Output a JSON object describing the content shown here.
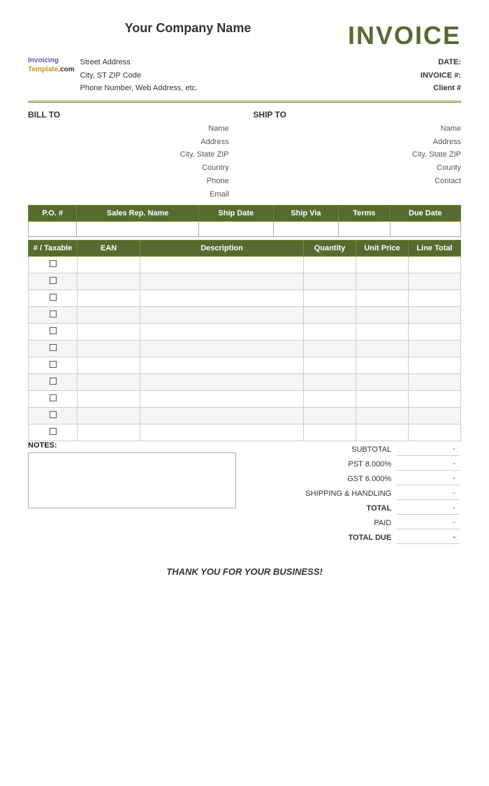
{
  "header": {
    "company_name": "Your Company Name",
    "invoice_title": "INVOICE"
  },
  "logo": {
    "line1": "Invoicing",
    "line2": "Template",
    "line3": ".com"
  },
  "company_address": {
    "street": "Street Address",
    "city_state_zip": "City, ST  ZIP Code",
    "phone_web": "Phone Number, Web Address, etc."
  },
  "meta": {
    "date_label": "DATE:",
    "invoice_num_label": "INVOICE #:",
    "client_label": "Client #"
  },
  "bill_to": {
    "header": "BILL TO",
    "name": "Name",
    "address": "Address",
    "city_state_zip": "City, State ZIP",
    "country": "Country",
    "phone": "Phone",
    "email": "Email"
  },
  "ship_to": {
    "header": "SHIP TO",
    "name": "Name",
    "address": "Address",
    "city_state_zip": "City, State ZIP",
    "country": "County",
    "contact": "Contact"
  },
  "order_table": {
    "headers": [
      "P.O. #",
      "Sales Rep. Name",
      "Ship Date",
      "Ship Via",
      "Terms",
      "Due Date"
    ]
  },
  "items_table": {
    "headers": [
      "# / Taxable",
      "EAN",
      "Description",
      "Quantity",
      "Unit Price",
      "Line Total"
    ],
    "rows": 11
  },
  "totals": {
    "subtotal_label": "SUBTOTAL",
    "pst_label": "PST",
    "pst_rate": "8.000%",
    "gst_label": "GST",
    "gst_rate": "6.000%",
    "shipping_label": "SHIPPING & HANDLING",
    "total_label": "TOTAL",
    "paid_label": "PAID",
    "total_due_label": "TOTAL DUE",
    "dash": "-"
  },
  "notes": {
    "label": "NOTES:"
  },
  "footer": {
    "thank_you": "THANK YOU FOR YOUR BUSINESS!"
  }
}
